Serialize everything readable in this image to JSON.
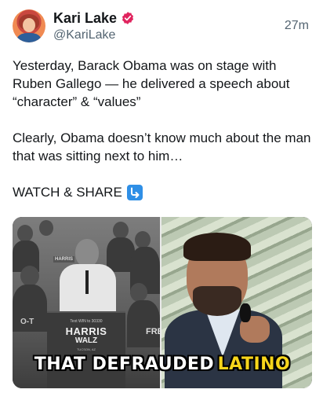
{
  "author": {
    "display_name": "Kari Lake",
    "handle": "@KariLake",
    "verified_icon": "verified-badge-icon",
    "verified_color": "#e0245e"
  },
  "timestamp": "27m",
  "tweet": {
    "paragraph1": "Yesterday, Barack Obama was on stage with Ruben Gallego — he delivered a speech about “character” & “values”",
    "paragraph2": "Clearly, Obama doesn’t know much about the man that was sitting next to him…",
    "paragraph3": "WATCH & SHARE",
    "paragraph3_icon": "arrow-down-right-icon"
  },
  "media": {
    "podium_subtitle": "Text WIN to 30330",
    "podium_harris": "HARRIS",
    "podium_walz": "WALZ",
    "podium_location": "TUCSON, AZ",
    "crowd_sign_small": "HARRIS",
    "crowd_sign_fre": "FRE",
    "crowd_sign_ot": "O-T",
    "caption_white": "THAT DEFRAUDED",
    "caption_yellow": "LATINO"
  },
  "colors": {
    "text": "#14171a",
    "secondary_text": "#536471",
    "share_icon_bg": "#2f8fe6",
    "caption_highlight": "#f7d51b"
  }
}
